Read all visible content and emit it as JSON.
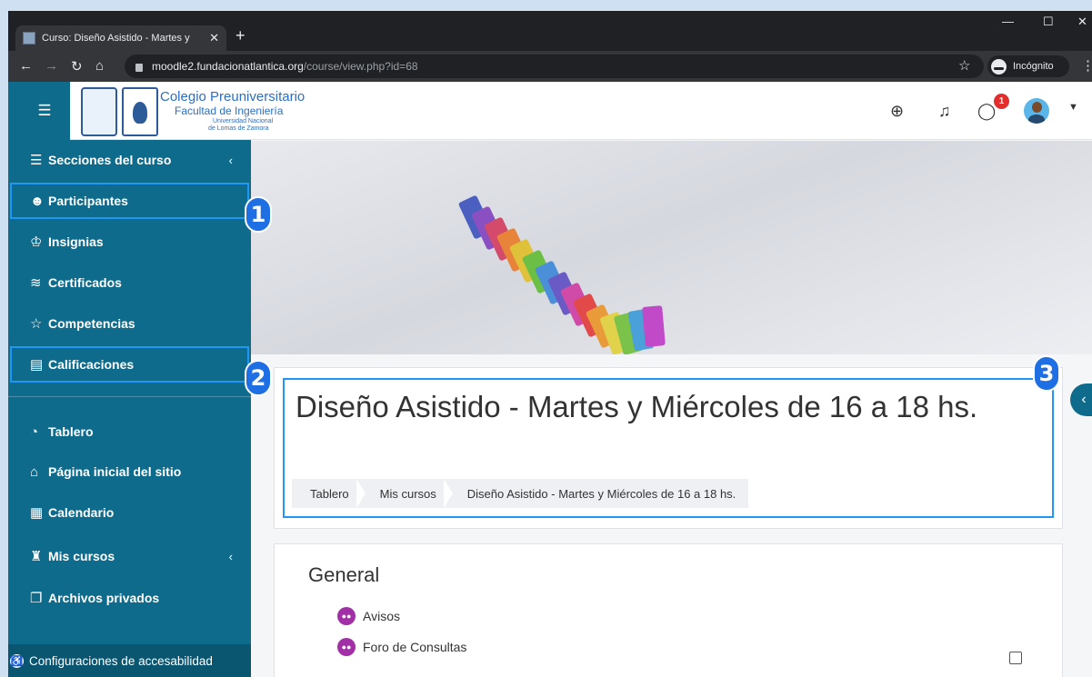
{
  "browser": {
    "tab_title": "Curso: Diseño Asistido - Martes y",
    "url_host": "moodle2.fundacionatlantica.org",
    "url_path": "/course/view.php?id=68",
    "incognito_label": "Incógnito"
  },
  "logo": {
    "line1": "Colegio Preuniversitario",
    "line2": "Facultad de Ingeniería",
    "line3": "Universidad Nacional",
    "line4": "de Lomas de Zamora"
  },
  "navbar": {
    "message_badge": "1",
    "icons": [
      "globe-icon",
      "bell-icon",
      "message-icon",
      "avatar",
      "caret-down-icon"
    ]
  },
  "sidebar": {
    "items": [
      {
        "label": "Secciones del curso",
        "icon": "list-icon"
      },
      {
        "label": "Participantes",
        "icon": "users-icon"
      },
      {
        "label": "Insignias",
        "icon": "badge-icon"
      },
      {
        "label": "Certificados",
        "icon": "certificate-icon"
      },
      {
        "label": "Competencias",
        "icon": "star-icon"
      },
      {
        "label": "Calificaciones",
        "icon": "grades-icon"
      },
      {
        "label": "Tablero",
        "icon": "dashboard-icon"
      },
      {
        "label": "Página inicial del sitio",
        "icon": "home-icon"
      },
      {
        "label": "Calendario",
        "icon": "calendar-icon"
      },
      {
        "label": "Mis cursos",
        "icon": "graduation-cap-icon"
      },
      {
        "label": "Archivos privados",
        "icon": "files-icon"
      }
    ],
    "accessibility": "Configuraciones de accesabilidad"
  },
  "page": {
    "title": "Diseño Asistido - Martes y Miércoles de 16 a 18 hs.",
    "breadcrumbs": [
      "Tablero",
      "Mis cursos",
      "Diseño Asistido - Martes y Miércoles de 16 a 18 hs."
    ]
  },
  "section": {
    "title": "General",
    "activities": [
      "Avisos",
      "Foro de Consultas"
    ]
  },
  "callouts": [
    "1",
    "2",
    "3"
  ],
  "colors": {
    "sidebar": "#0f6b8b",
    "callout": "#1e6fe3",
    "highlight": "#2196f3",
    "forum_icon": "#a12fa5"
  }
}
